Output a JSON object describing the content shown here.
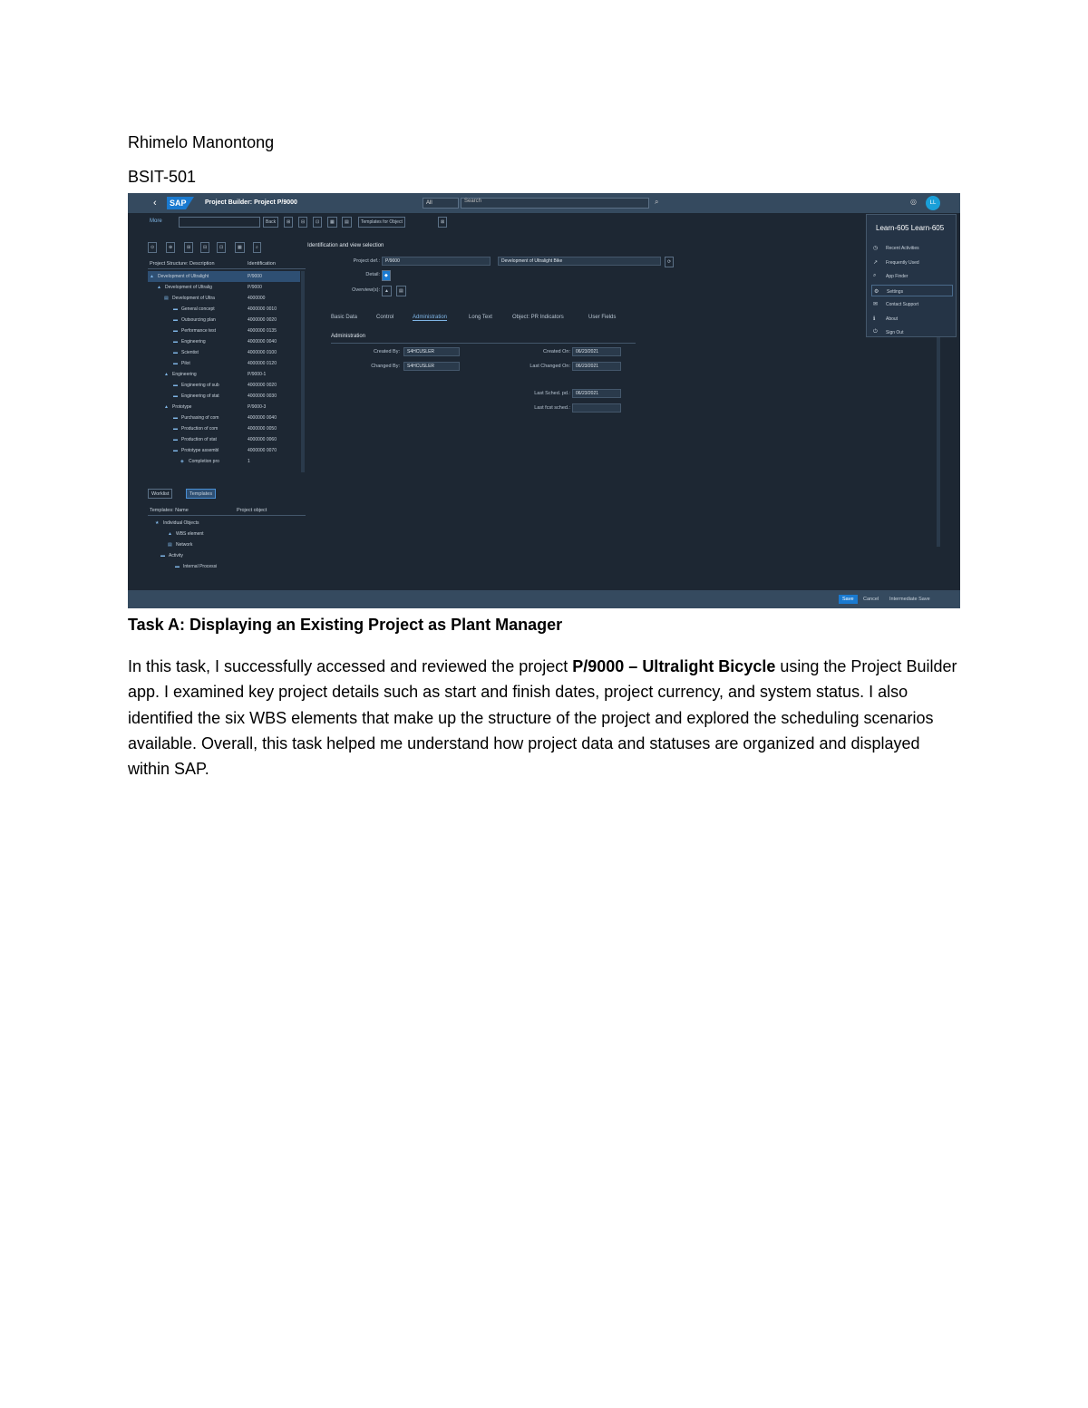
{
  "author": "Rhimelo Manontong",
  "section": "BSIT-501",
  "screenshot": {
    "app_title": "Project Builder: Project P/9000",
    "scope": "All",
    "search_placeholder": "Search",
    "avatar": "LL",
    "toolbar": {
      "more": "More",
      "back": "Back",
      "templates_for_object": "Templates for Object"
    },
    "tree": {
      "col_description": "Project Structure: Description",
      "col_identification": "Identification",
      "rows": [
        {
          "d": "Development of Ultralight",
          "i": "P/9000"
        },
        {
          "d": "Development of Ultralig",
          "i": "P/9000"
        },
        {
          "d": "Development of Ultra",
          "i": "4000000"
        },
        {
          "d": "General concept",
          "i": "4000000 0010"
        },
        {
          "d": "Outsourcing plan",
          "i": "4000000 0020"
        },
        {
          "d": "Performance test",
          "i": "4000000 0135"
        },
        {
          "d": "Engineering",
          "i": "4000000 0040"
        },
        {
          "d": "Scientist",
          "i": "4000000 0100"
        },
        {
          "d": "Pilot",
          "i": "4000000 0120"
        },
        {
          "d": "Engineering",
          "i": "P/9000-1"
        },
        {
          "d": "Engineering of sub",
          "i": "4000000 0020"
        },
        {
          "d": "Engineering of stat",
          "i": "4000000 0030"
        },
        {
          "d": "Prototype",
          "i": "P/9000-3"
        },
        {
          "d": "Purchasing of com",
          "i": "4000000 0040"
        },
        {
          "d": "Production of com",
          "i": "4000000 0050"
        },
        {
          "d": "Production of stat",
          "i": "4000000 0060"
        },
        {
          "d": "Prototype assembl",
          "i": "4000000 0070"
        },
        {
          "d": "Completion pro",
          "i": "1"
        }
      ]
    },
    "bottom": {
      "worklist": "Worklist",
      "templates": "Templates",
      "col_name": "Templates: Name",
      "col_object": "Project object",
      "rows": [
        "Individual Objects",
        "WBS element",
        "Network",
        "Activity",
        "Internal Processi"
      ]
    },
    "main": {
      "section": "Identification and view selection",
      "project_def_label": "Project def.:",
      "project_def": "P/9000",
      "project_desc": "Development of Ultralight Bike",
      "detail_label": "Detail:",
      "overviews_label": "Overview(s):",
      "tabs": [
        "Basic Data",
        "Control",
        "Administration",
        "Long Text",
        "Object: PR Indicators",
        "User Fields"
      ],
      "admin_title": "Administration",
      "created_by_label": "Created By:",
      "created_by": "S4HCUSLER",
      "changed_by_label": "Changed By:",
      "changed_by": "S4HCUSLER",
      "created_on_label": "Created On:",
      "created_on": "06/23/2021",
      "last_changed_label": "Last Changed On:",
      "last_changed": "06/23/2021",
      "last_sched_label": "Last Sched. pd.:",
      "last_sched": "06/23/2021",
      "last_fcst_label": "Last fcst sched.:"
    },
    "usermenu": {
      "name": "Learn-605 Learn-605",
      "items": [
        {
          "icon": "recent-icon",
          "label": "Recent Activities"
        },
        {
          "icon": "frequent-icon",
          "label": "Frequently Used"
        },
        {
          "icon": "finder-icon",
          "label": "App Finder"
        },
        {
          "icon": "settings-icon",
          "label": "Settings"
        },
        {
          "icon": "support-icon",
          "label": "Contact Support"
        },
        {
          "icon": "info-icon",
          "label": "About"
        },
        {
          "icon": "signout-icon",
          "label": "Sign Out"
        }
      ]
    },
    "footer": {
      "save": "Save",
      "cancel": "Cancel",
      "intermediate_save": "Intermediate Save"
    }
  },
  "task_title": "Task A: Displaying an Existing Project as Plant Manager",
  "paragraph": {
    "p1": "In this task, I successfully accessed and reviewed the project ",
    "bold1": "P/9000 – Ultralight Bicycle",
    "p2": " using the Project Builder app. I examined key project details such as start and finish dates, project currency, and system status. I also identified the six WBS elements that make up the structure of the project and explored the scheduling scenarios available. Overall, this task helped me understand how project data and statuses are organized and displayed within SAP."
  }
}
